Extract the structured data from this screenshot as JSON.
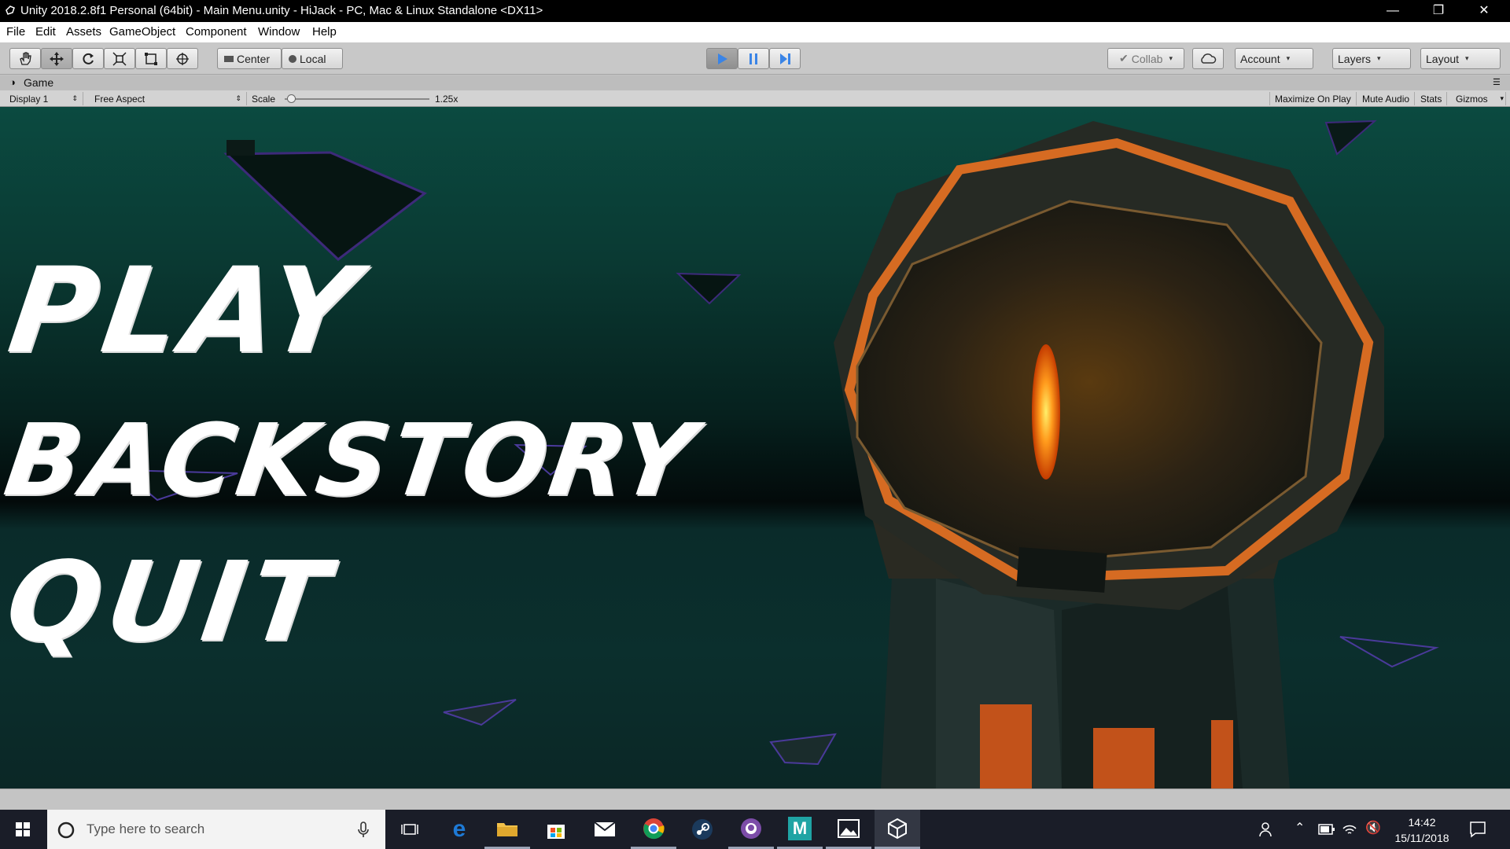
{
  "window": {
    "title": "Unity 2018.2.8f1 Personal (64bit) - Main Menu.unity - HiJack - PC, Mac & Linux Standalone <DX11>",
    "controls": [
      "minimize",
      "restore",
      "close"
    ]
  },
  "menubar": {
    "items": [
      "File",
      "Edit",
      "Assets",
      "GameObject",
      "Component",
      "Window",
      "Help"
    ]
  },
  "toolbar": {
    "tools": [
      "hand-tool",
      "move-tool",
      "rotate-tool",
      "scale-tool",
      "rect-tool",
      "transform-tool"
    ],
    "pivot_mode": "Center",
    "pivot_rotation": "Local",
    "play_icons": [
      "play",
      "pause",
      "step"
    ],
    "collab": "Collab",
    "account": "Account",
    "layers": "Layers",
    "layout": "Layout"
  },
  "game_tab": {
    "title": "Game",
    "display": "Display 1",
    "aspect": "Free Aspect",
    "scale_label": "Scale",
    "scale_value": "1.25x",
    "scale_fraction": 0.02,
    "maximize_on_play": "Maximize On Play",
    "mute_audio": "Mute Audio",
    "stats": "Stats",
    "gizmos": "Gizmos"
  },
  "game_menu": {
    "play": "PLAY",
    "backstory": "BACKSTORY",
    "quit": "QUIT"
  },
  "taskbar": {
    "search_placeholder": "Type here to search",
    "time": "14:42",
    "date": "15/11/2018",
    "apps": [
      "task-view",
      "edge",
      "file-explorer",
      "store",
      "mail",
      "chrome",
      "steam",
      "github",
      "maya",
      "photos",
      "unity"
    ]
  },
  "colors": {
    "play_active": "#3a84e6",
    "taskbar_bg": "#1a1d28",
    "portal_orange": "#ff8a1a"
  }
}
